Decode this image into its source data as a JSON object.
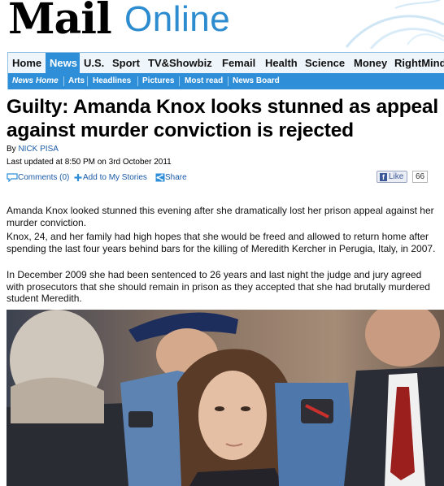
{
  "masthead": {
    "brand_mail": "Mail",
    "brand_online": "Online",
    "colors": {
      "brand_blue": "#2c8ccf"
    }
  },
  "nav": {
    "tabs": [
      {
        "label": "Home"
      },
      {
        "label": "News",
        "active": true
      },
      {
        "label": "U.S."
      },
      {
        "label": "Sport"
      },
      {
        "label": "TV&Showbiz"
      },
      {
        "label": "Femail"
      },
      {
        "label": "Health"
      },
      {
        "label": "Science"
      },
      {
        "label": "Money"
      },
      {
        "label": "RightMinds"
      }
    ],
    "subnav": [
      {
        "label": "News Home"
      },
      {
        "label": "Arts"
      },
      {
        "label": "Headlines"
      },
      {
        "label": "Pictures"
      },
      {
        "label": "Most read"
      },
      {
        "label": "News Board"
      }
    ],
    "colors": {
      "active_tab": "#2e8fd8",
      "tab_bar": "#eef5fb"
    }
  },
  "article": {
    "headline": "Guilty: Amanda Knox looks stunned as appeal against murder conviction is rejected",
    "byline_prefix": "By",
    "author": "NICK PISA",
    "updated": "Last updated at 8:50 PM on 3rd October 2011",
    "social": {
      "comments": "Comments (0)",
      "add_to_stories": "Add to My Stories",
      "share": "Share",
      "fb_like": "Like",
      "fb_count": "66"
    },
    "paragraphs": [
      "Amanda Knox looked stunned this evening after she dramatically lost her prison appeal against her murder conviction.",
      "Knox, 24, and her family had high hopes that she would be freed and allowed to return home after spending the last four years behind bars for the killing of Meredith Kercher in Perugia, Italy, in 2007.",
      "In December 2009 she had been sentenced to 26 years and last night the judge and jury agreed with prosecutors that she should remain in prison as they accepted that she had brutally murdered student Meredith."
    ]
  }
}
